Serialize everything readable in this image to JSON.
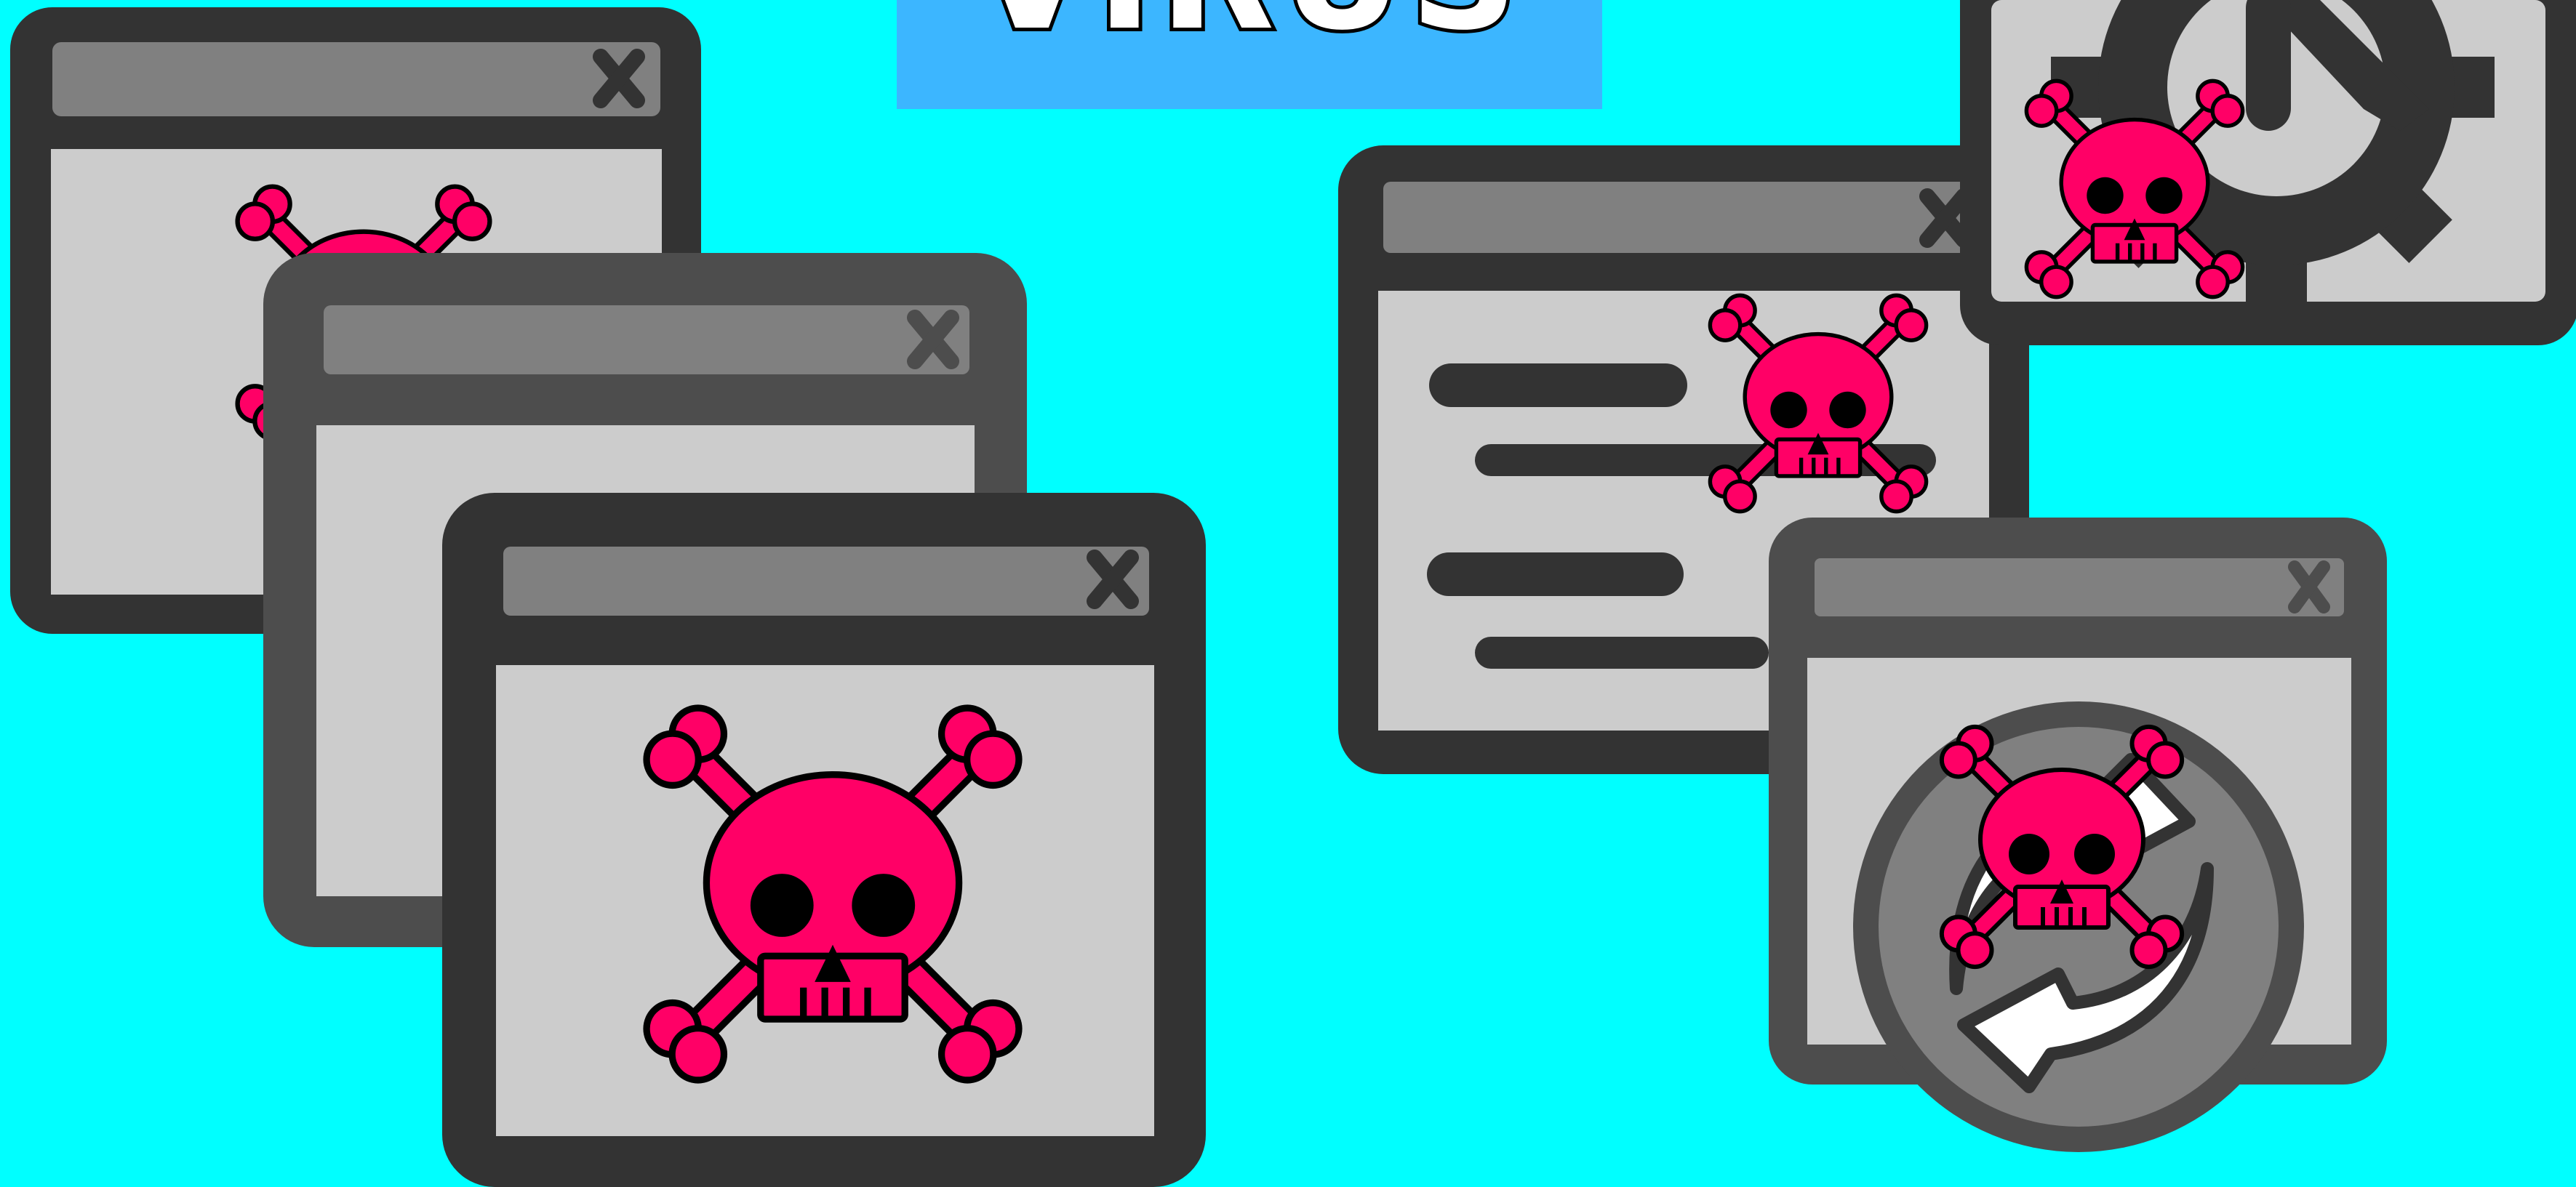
{
  "banner": {
    "text": "VIRUS"
  },
  "colors": {
    "background": "#00ffff",
    "banner": "#3cb6ff",
    "skull": "#ff0066",
    "window_frame_dark": "#333333",
    "window_frame_medium": "#4d4d4d",
    "titlebar": "#808080",
    "window_body": "#cccccc",
    "outline": "#000000"
  },
  "icons": {
    "window_close": "close-x-icon",
    "skull": "skull-crossbones-icon",
    "settings": "gear-icon",
    "sync": "refresh-arrows-icon"
  }
}
